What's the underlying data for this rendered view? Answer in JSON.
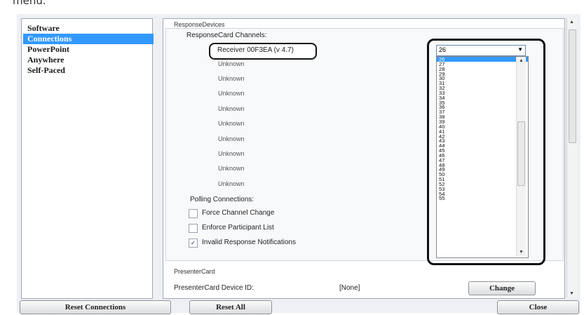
{
  "top_fragment": "menu.",
  "sidebar": {
    "items": [
      {
        "label": "Software",
        "selected": false
      },
      {
        "label": "Connections",
        "selected": true
      },
      {
        "label": "PowerPoint",
        "selected": false
      },
      {
        "label": "Anywhere",
        "selected": false
      },
      {
        "label": "Self-Paced",
        "selected": false
      }
    ]
  },
  "response_devices": {
    "section_label": "ResponseDevices",
    "channels_label": "ResponseCard Channels:",
    "receiver": "Receiver 00F3EA (v 4.7)",
    "unknown_label": "Unknown",
    "unknown_rows": [
      "Unknown",
      "Unknown",
      "Unknown",
      "Unknown",
      "Unknown",
      "Unknown",
      "Unknown",
      "Unknown",
      "Unknown"
    ],
    "polling_label": "Polling Connections:",
    "options": [
      {
        "label": "Force Channel Change",
        "checked": false
      },
      {
        "label": "Enforce Participant List",
        "checked": false
      },
      {
        "label": "Invalid Response Notifications",
        "checked": true
      }
    ]
  },
  "channel_dropdown": {
    "selected_value": "26",
    "options": [
      "26",
      "27",
      "28",
      "29",
      "30",
      "31",
      "32",
      "33",
      "34",
      "35",
      "36",
      "37",
      "38",
      "39",
      "40",
      "41",
      "42",
      "43",
      "44",
      "45",
      "46",
      "47",
      "48",
      "49",
      "50",
      "51",
      "52",
      "53",
      "54",
      "55"
    ]
  },
  "presenter_card": {
    "section_label": "PresenterCard",
    "device_id_label": "PresenterCard Device ID:",
    "device_id_value": "[None]",
    "change_button": "Change"
  },
  "footer": {
    "reset_connections": "Reset Connections",
    "reset_all": "Reset All",
    "close": "Close"
  },
  "colors": {
    "selection": "#3399ff",
    "border": "#9fa8b8"
  }
}
